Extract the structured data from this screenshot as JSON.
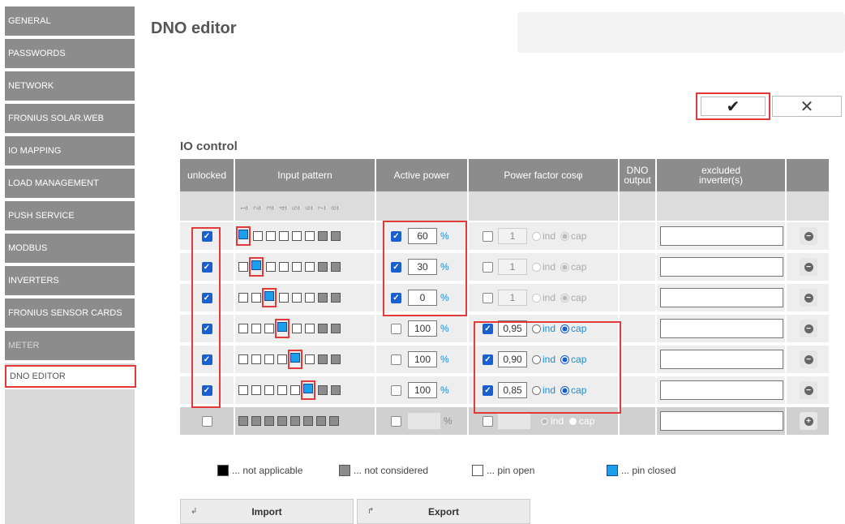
{
  "sidebar": {
    "items": [
      {
        "label": "GENERAL"
      },
      {
        "label": "PASSWORDS"
      },
      {
        "label": "NETWORK"
      },
      {
        "label": "FRONIUS SOLAR.WEB"
      },
      {
        "label": "IO MAPPING"
      },
      {
        "label": "LOAD MANAGEMENT"
      },
      {
        "label": "PUSH SERVICE"
      },
      {
        "label": "MODBUS"
      },
      {
        "label": "INVERTERS"
      },
      {
        "label": "FRONIUS SENSOR CARDS"
      },
      {
        "label": "METER"
      },
      {
        "label": "DNO EDITOR"
      }
    ]
  },
  "header": {
    "title": "DNO editor",
    "confirm_glyph": "✔",
    "cancel_glyph": "✕"
  },
  "io_control": {
    "title": "IO control",
    "columns": {
      "unlocked": "unlocked",
      "input_pattern": "Input pattern",
      "active_power": "Active power",
      "power_factor": "Power factor cosφ",
      "dno_output_1": "DNO",
      "dno_output_2": "output",
      "excluded_1": "excluded",
      "excluded_2": "inverter(s)"
    },
    "pin_numbers": [
      "1",
      "2",
      "3",
      "4",
      "5",
      "6",
      "7",
      "8"
    ],
    "percent_unit": "%",
    "ind_label": "ind",
    "cap_label": "cap",
    "rows": [
      {
        "unlocked": true,
        "closed_pin": 1,
        "ap_on": true,
        "ap_value": "60",
        "pf_on": false,
        "pf_value": "1",
        "pf_mode": "cap",
        "dno": true,
        "excluded": ""
      },
      {
        "unlocked": true,
        "closed_pin": 2,
        "ap_on": true,
        "ap_value": "30",
        "pf_on": false,
        "pf_value": "1",
        "pf_mode": "cap",
        "dno": true,
        "excluded": ""
      },
      {
        "unlocked": true,
        "closed_pin": 3,
        "ap_on": true,
        "ap_value": "0",
        "pf_on": false,
        "pf_value": "1",
        "pf_mode": "cap",
        "dno": true,
        "excluded": ""
      },
      {
        "unlocked": true,
        "closed_pin": 4,
        "ap_on": false,
        "ap_value": "100",
        "pf_on": true,
        "pf_value": "0,95",
        "pf_mode": "cap",
        "dno": true,
        "excluded": ""
      },
      {
        "unlocked": true,
        "closed_pin": 5,
        "ap_on": false,
        "ap_value": "100",
        "pf_on": true,
        "pf_value": "0,90",
        "pf_mode": "cap",
        "dno": true,
        "excluded": ""
      },
      {
        "unlocked": true,
        "closed_pin": 6,
        "ap_on": false,
        "ap_value": "100",
        "pf_on": true,
        "pf_value": "0,85",
        "pf_mode": "cap",
        "dno": true,
        "excluded": ""
      }
    ]
  },
  "legend": {
    "not_applicable": "... not applicable",
    "not_considered": "... not considered",
    "pin_open": "... pin open",
    "pin_closed": "... pin closed"
  },
  "footer": {
    "import_label": "Import",
    "export_label": "Export"
  },
  "colors": {
    "sidebar": "#8c8c8c",
    "highlight": "#e03a3a",
    "checkbox": "#1a5fd0",
    "pin_closed": "#1aa0ea"
  }
}
